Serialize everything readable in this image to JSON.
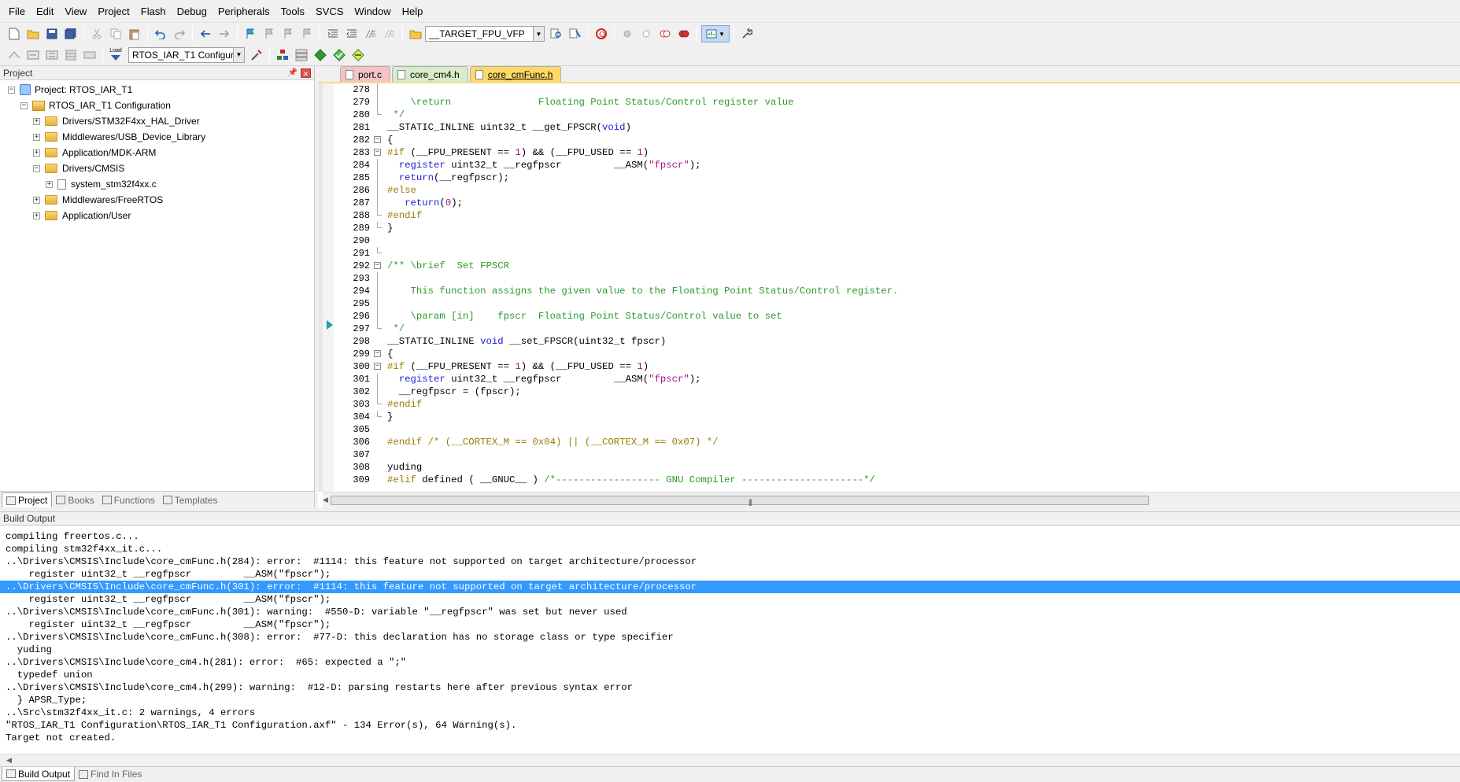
{
  "menu": [
    "File",
    "Edit",
    "View",
    "Project",
    "Flash",
    "Debug",
    "Peripherals",
    "Tools",
    "SVCS",
    "Window",
    "Help"
  ],
  "toolbar": {
    "target_select": "__TARGET_FPU_VFP",
    "config_select": "RTOS_IAR_T1 Configurati",
    "load_label": "Load"
  },
  "project_panel": {
    "title": "Project",
    "tree": [
      {
        "label": "Project: RTOS_IAR_T1",
        "type": "project",
        "exp": "−"
      },
      {
        "label": "RTOS_IAR_T1 Configuration",
        "type": "config",
        "exp": "−"
      },
      {
        "label": "Drivers/STM32F4xx_HAL_Driver",
        "type": "folder",
        "exp": "+"
      },
      {
        "label": "Middlewares/USB_Device_Library",
        "type": "folder",
        "exp": "+"
      },
      {
        "label": "Application/MDK-ARM",
        "type": "folder",
        "exp": "+"
      },
      {
        "label": "Drivers/CMSIS",
        "type": "folder",
        "exp": "−"
      },
      {
        "label": "system_stm32f4xx.c",
        "type": "file",
        "exp": "+"
      },
      {
        "label": "Middlewares/FreeRTOS",
        "type": "folder",
        "exp": "+"
      },
      {
        "label": "Application/User",
        "type": "folder",
        "exp": "+"
      }
    ],
    "tabs": [
      "Project",
      "Books",
      "Functions",
      "Templates"
    ],
    "active_tab": "Project"
  },
  "editor": {
    "tabs": [
      "port.c",
      "core_cm4.h",
      "core_cmFunc.h"
    ],
    "active_tab": "core_cmFunc.h",
    "current_line": 301,
    "lines": [
      {
        "n": "278",
        "fold": "v",
        "t": []
      },
      {
        "n": "279",
        "fold": "v",
        "t": [
          [
            "cm",
            "    \\return               Floating Point Status/Control register value"
          ]
        ]
      },
      {
        "n": "280",
        "fold": "e",
        "t": [
          [
            "cm",
            " */"
          ]
        ]
      },
      {
        "n": "281",
        "fold": "",
        "t": [
          [
            "",
            "__STATIC_INLINE uint32_t __get_FPSCR("
          ],
          [
            "kw",
            "void"
          ],
          [
            "",
            ")"
          ]
        ]
      },
      {
        "n": "282",
        "fold": "b",
        "t": [
          [
            "",
            "{"
          ]
        ]
      },
      {
        "n": "283",
        "fold": "b",
        "t": [
          [
            "pp",
            "#if"
          ],
          [
            "",
            " (__FPU_PRESENT == "
          ],
          [
            "nm",
            "1"
          ],
          [
            "",
            ") && (__FPU_USED == "
          ],
          [
            "nm",
            "1"
          ],
          [
            "",
            ")"
          ]
        ]
      },
      {
        "n": "284",
        "fold": "v",
        "t": [
          [
            "",
            "  "
          ],
          [
            "kw",
            "register"
          ],
          [
            "",
            " uint32_t __regfpscr         __ASM("
          ],
          [
            "st",
            "\"fpscr\""
          ],
          [
            "",
            ");"
          ]
        ]
      },
      {
        "n": "285",
        "fold": "v",
        "t": [
          [
            "",
            "  "
          ],
          [
            "kw",
            "return"
          ],
          [
            "",
            "(__regfpscr);"
          ]
        ]
      },
      {
        "n": "286",
        "fold": "v",
        "t": [
          [
            "pp",
            "#else"
          ]
        ]
      },
      {
        "n": "287",
        "fold": "v",
        "t": [
          [
            "",
            "   "
          ],
          [
            "kw",
            "return"
          ],
          [
            "",
            "("
          ],
          [
            "nm",
            "0"
          ],
          [
            "",
            ");"
          ]
        ]
      },
      {
        "n": "288",
        "fold": "e",
        "t": [
          [
            "pp",
            "#endif"
          ]
        ]
      },
      {
        "n": "289",
        "fold": "e",
        "t": [
          [
            "",
            "}"
          ]
        ]
      },
      {
        "n": "290",
        "fold": "",
        "t": []
      },
      {
        "n": "291",
        "fold": "e",
        "t": []
      },
      {
        "n": "292",
        "fold": "b",
        "t": [
          [
            "cm",
            "/** \\brief  Set FPSCR"
          ]
        ]
      },
      {
        "n": "293",
        "fold": "v",
        "t": []
      },
      {
        "n": "294",
        "fold": "v",
        "t": [
          [
            "cm",
            "    This function assigns the given value to the Floating Point Status/Control register."
          ]
        ]
      },
      {
        "n": "295",
        "fold": "v",
        "t": []
      },
      {
        "n": "296",
        "fold": "v",
        "t": [
          [
            "cm",
            "    \\param [in]    fpscr  Floating Point Status/Control value to set"
          ]
        ]
      },
      {
        "n": "297",
        "fold": "e",
        "t": [
          [
            "cm",
            " */"
          ]
        ]
      },
      {
        "n": "298",
        "fold": "",
        "t": [
          [
            "",
            "__STATIC_INLINE "
          ],
          [
            "kw",
            "void"
          ],
          [
            "",
            " __set_FPSCR(uint32_t fpscr)"
          ]
        ]
      },
      {
        "n": "299",
        "fold": "b",
        "t": [
          [
            "",
            "{"
          ]
        ]
      },
      {
        "n": "300",
        "fold": "b",
        "t": [
          [
            "pp",
            "#if"
          ],
          [
            "",
            " (__FPU_PRESENT == "
          ],
          [
            "nm",
            "1"
          ],
          [
            "",
            ") && (__FPU_USED == "
          ],
          [
            "nm",
            "1"
          ],
          [
            "",
            ")"
          ]
        ]
      },
      {
        "n": "301",
        "fold": "v",
        "t": [
          [
            "",
            "  "
          ],
          [
            "kw",
            "register"
          ],
          [
            "",
            " uint32_t __regfpscr         __ASM("
          ],
          [
            "st",
            "\"fpscr\""
          ],
          [
            "",
            ");"
          ]
        ]
      },
      {
        "n": "302",
        "fold": "v",
        "t": [
          [
            "",
            "  __regfpscr = (fpscr);"
          ]
        ]
      },
      {
        "n": "303",
        "fold": "e",
        "t": [
          [
            "pp",
            "#endif"
          ]
        ]
      },
      {
        "n": "304",
        "fold": "e",
        "t": [
          [
            "",
            "}"
          ]
        ]
      },
      {
        "n": "305",
        "fold": "",
        "t": []
      },
      {
        "n": "306",
        "fold": "",
        "t": [
          [
            "pp",
            "#endif /* (__CORTEX_M == 0x04) || (__CORTEX_M == 0x07) */"
          ]
        ]
      },
      {
        "n": "307",
        "fold": "",
        "t": []
      },
      {
        "n": "308",
        "fold": "",
        "t": [
          [
            "",
            "yuding"
          ]
        ]
      },
      {
        "n": "309",
        "fold": "",
        "t": [
          [
            "pp",
            "#elif"
          ],
          [
            "",
            " defined ( __GNUC__ ) "
          ],
          [
            "cm",
            "/*------------------ GNU Compiler ---------------------*/"
          ]
        ]
      }
    ]
  },
  "build_output": {
    "title": "Build Output",
    "lines": [
      "compiling freertos.c...",
      "compiling stm32f4xx_it.c...",
      "..\\Drivers\\CMSIS\\Include\\core_cmFunc.h(284): error:  #1114: this feature not supported on target architecture/processor",
      "    register uint32_t __regfpscr         __ASM(\"fpscr\");",
      "..\\Drivers\\CMSIS\\Include\\core_cmFunc.h(301): error:  #1114: this feature not supported on target architecture/processor",
      "    register uint32_t __regfpscr         __ASM(\"fpscr\");",
      "..\\Drivers\\CMSIS\\Include\\core_cmFunc.h(301): warning:  #550-D: variable \"__regfpscr\" was set but never used",
      "    register uint32_t __regfpscr         __ASM(\"fpscr\");",
      "..\\Drivers\\CMSIS\\Include\\core_cmFunc.h(308): error:  #77-D: this declaration has no storage class or type specifier",
      "  yuding",
      "..\\Drivers\\CMSIS\\Include\\core_cm4.h(281): error:  #65: expected a \";\"",
      "  typedef union",
      "..\\Drivers\\CMSIS\\Include\\core_cm4.h(299): warning:  #12-D: parsing restarts here after previous syntax error",
      "  } APSR_Type;",
      "..\\Src\\stm32f4xx_it.c: 2 warnings, 4 errors",
      "\"RTOS_IAR_T1 Configuration\\RTOS_IAR_T1 Configuration.axf\" - 134 Error(s), 64 Warning(s).",
      "Target not created."
    ],
    "selected_index": 4,
    "tabs": [
      "Build Output",
      "Find In Files"
    ],
    "active_tab": "Build Output"
  }
}
